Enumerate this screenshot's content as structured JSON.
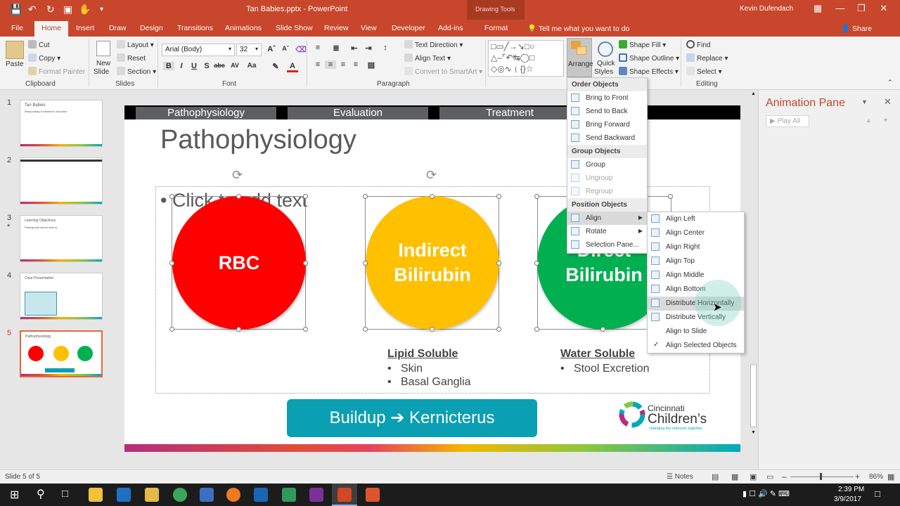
{
  "window": {
    "doc_title": "Tan Babies.pptx  -  PowerPoint",
    "context_label": "Drawing Tools",
    "user": "Kevin Dufendach",
    "controls": [
      "—",
      "❐",
      "✕"
    ]
  },
  "ribbon_tabs": [
    "File",
    "Home",
    "Insert",
    "Draw",
    "Design",
    "Transitions",
    "Animations",
    "Slide Show",
    "Review",
    "View",
    "Developer",
    "Add-ins",
    "Format"
  ],
  "active_tab": "Home",
  "tell_me": "Tell me what you want to do",
  "share": "Share",
  "ribbon": {
    "clipboard": {
      "paste": "Paste",
      "cut": "Cut",
      "copy": "Copy",
      "format_painter": "Format Painter",
      "label": "Clipboard"
    },
    "slides": {
      "new_slide_1": "New",
      "new_slide_2": "Slide",
      "layout": "Layout",
      "reset": "Reset",
      "section": "Section",
      "label": "Slides"
    },
    "font": {
      "family": "Arial (Body)",
      "size": "32",
      "label": "Font"
    },
    "paragraph": {
      "text_direction": "Text Direction",
      "align_text": "Align Text",
      "smartart": "Convert to SmartArt",
      "label": "Paragraph"
    },
    "drawing": {
      "arrange": "Arrange",
      "quick_1": "Quick",
      "quick_2": "Styles",
      "shape_fill": "Shape Fill",
      "shape_outline": "Shape Outline",
      "shape_effects": "Shape Effects"
    },
    "editing": {
      "find": "Find",
      "replace": "Replace",
      "select": "Select",
      "label": "Editing"
    }
  },
  "slides": [
    {
      "num": "1",
      "title": "Tan Babies",
      "sub": "Responding to Newborn Jaundice"
    },
    {
      "num": "2",
      "title": "",
      "sub": ""
    },
    {
      "num": "3",
      "title": "Learning Objectives",
      "sub": "Participants will be able to:",
      "star": "*"
    },
    {
      "num": "4",
      "title": "Case Presentation",
      "sub": ""
    },
    {
      "num": "5",
      "title": "Pathophysiology",
      "sub": ""
    }
  ],
  "slide": {
    "nav_tabs": [
      "Pathophysiology",
      "Evaluation",
      "Treatment"
    ],
    "title": "Pathophysiology",
    "placeholder": "Click to add text",
    "circles": [
      {
        "label": "RBC",
        "color": "#ff0000"
      },
      {
        "label": "Indirect Bilirubin",
        "color": "#ffc000"
      },
      {
        "label": "Direct Bilirubin",
        "color": "#00b050"
      }
    ],
    "notes": [
      {
        "heading": "Lipid Soluble",
        "items": [
          "Skin",
          "Basal Ganglia"
        ]
      },
      {
        "heading": "Water Soluble",
        "items": [
          "Stool Excretion"
        ]
      }
    ],
    "button": "Buildup ➔ Kernicterus",
    "logo_line1": "Cincinnati",
    "logo_line2": "Children’s",
    "logo_tagline": "changing the outcome together"
  },
  "arrange_menu": {
    "order_header": "Order Objects",
    "order_items": [
      "Bring to Front",
      "Send to Back",
      "Bring Forward",
      "Send Backward"
    ],
    "group_header": "Group Objects",
    "group_items": [
      "Group",
      "Ungroup",
      "Regroup"
    ],
    "position_header": "Position Objects",
    "position_items": [
      "Align",
      "Rotate",
      "Selection Pane..."
    ]
  },
  "align_menu": {
    "items": [
      "Align Left",
      "Align Center",
      "Align Right",
      "Align Top",
      "Align Middle",
      "Align Bottom",
      "Distribute Horizontally",
      "Distribute Vertically",
      "Align to Slide",
      "Align Selected Objects"
    ],
    "highlighted": "Distribute Horizontally",
    "checked": "Align Selected Objects"
  },
  "animation_pane": {
    "title": "Animation Pane",
    "play_all": "Play All"
  },
  "status": {
    "slide_info": "Slide 5 of 5",
    "notes": "Notes",
    "zoom": "86%"
  },
  "clock": {
    "time": "2:39 PM",
    "date": "3/9/2017"
  },
  "colors": {
    "accent": "#c8462b",
    "button": "#0b9fb3"
  }
}
